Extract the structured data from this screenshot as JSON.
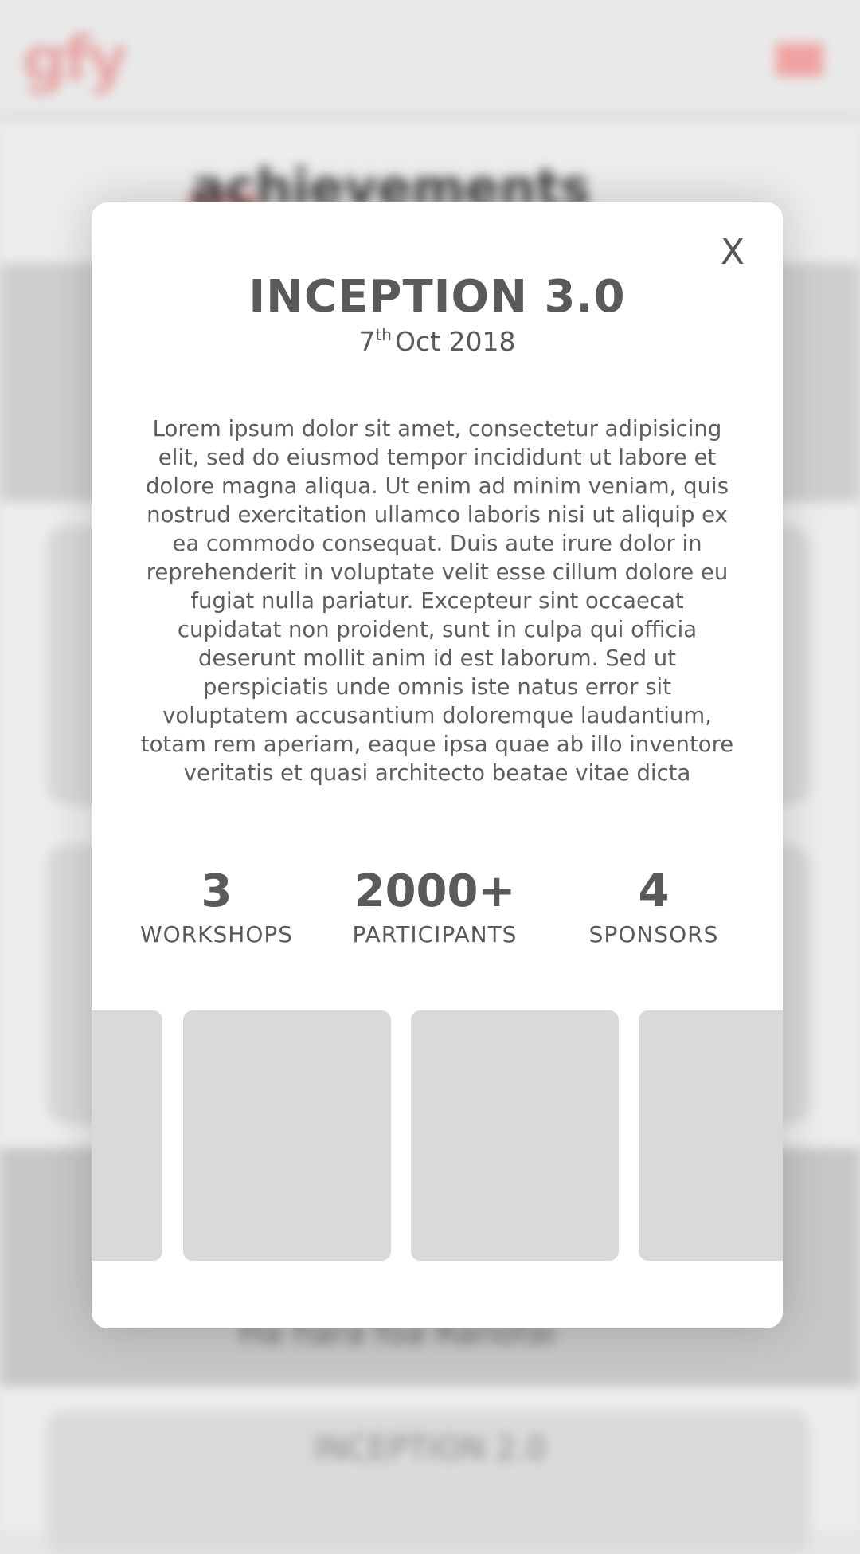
{
  "background": {
    "logo_text": "gfy",
    "section_heading": "achievements",
    "band_text": "Ha hara foa Ranofai",
    "card_title": "INCEPTION 2.0"
  },
  "modal": {
    "close_label": "X",
    "title": "INCEPTION 3.0",
    "date": {
      "day": "7",
      "suffix": "th",
      "rest": "Oct 2018"
    },
    "description": "Lorem ipsum dolor sit amet, consectetur adipisicing elit, sed do eiusmod tempor incididunt ut labore et dolore magna aliqua. Ut enim ad minim veniam, quis nostrud exercitation ullamco laboris nisi ut aliquip ex ea commodo consequat. Duis aute irure dolor in reprehenderit in voluptate velit esse cillum dolore eu fugiat nulla pariatur. Excepteur sint occaecat cupidatat non proident, sunt in culpa qui officia deserunt mollit anim id est laborum. Sed ut perspiciatis unde omnis iste natus error sit voluptatem accusantium doloremque laudantium, totam rem aperiam, eaque ipsa quae ab illo inventore veritatis et quasi architecto beatae vitae dicta",
    "stats": [
      {
        "value": "3",
        "label": "WORKSHOPS"
      },
      {
        "value": "2000+",
        "label": "PARTICIPANTS"
      },
      {
        "value": "4",
        "label": "SPONSORS"
      }
    ],
    "gallery_tile_count": 4
  },
  "colors": {
    "text": "#5a5a5a",
    "tile": "#d9d9d9",
    "accent": "#e7a3a3"
  }
}
